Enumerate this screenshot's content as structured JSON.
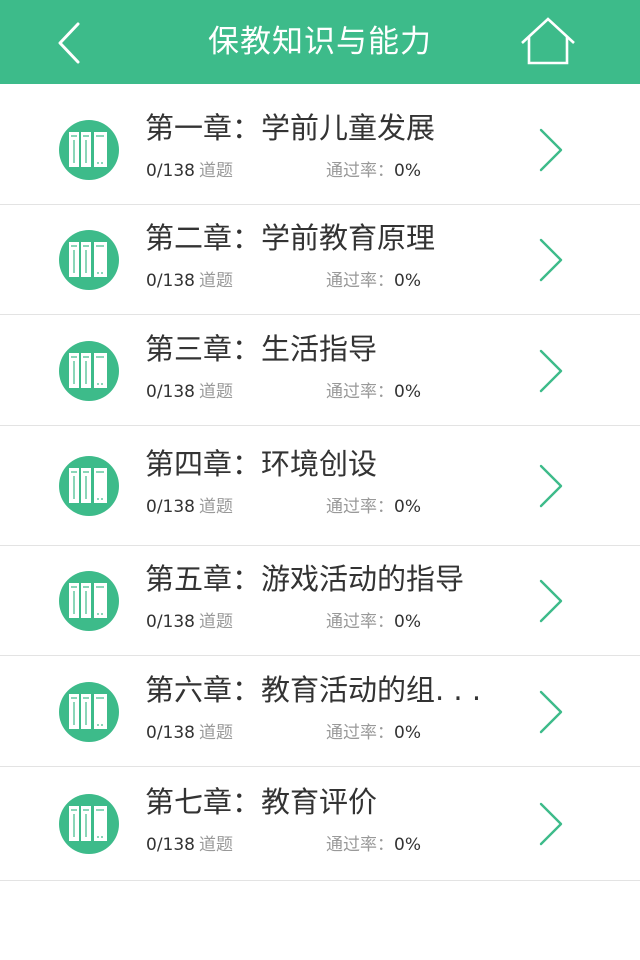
{
  "header": {
    "title": "保教知识与能力",
    "back_icon": "chevron-left-icon",
    "home_icon": "home-icon",
    "background_color": "#3dbb8a"
  },
  "list": {
    "count_unit": "道题",
    "rate_label": "通过率：",
    "item_icon": "book-icon",
    "arrow_icon": "chevron-right-icon",
    "accent_color": "#3dbb8a",
    "items": [
      {
        "title": "第一章：学前儿童发展",
        "count": "0/138",
        "rate": "0%"
      },
      {
        "title": "第二章：学前教育原理",
        "count": "0/138",
        "rate": "0%"
      },
      {
        "title": "第三章：生活指导",
        "count": "0/138",
        "rate": "0%"
      },
      {
        "title": "第四章：环境创设",
        "count": "0/138",
        "rate": "0%"
      },
      {
        "title": "第五章：游戏活动的指导",
        "count": "0/138",
        "rate": "0%"
      },
      {
        "title": "第六章：教育活动的组. . .",
        "count": "0/138",
        "rate": "0%"
      },
      {
        "title": "第七章：教育评价",
        "count": "0/138",
        "rate": "0%"
      }
    ]
  }
}
